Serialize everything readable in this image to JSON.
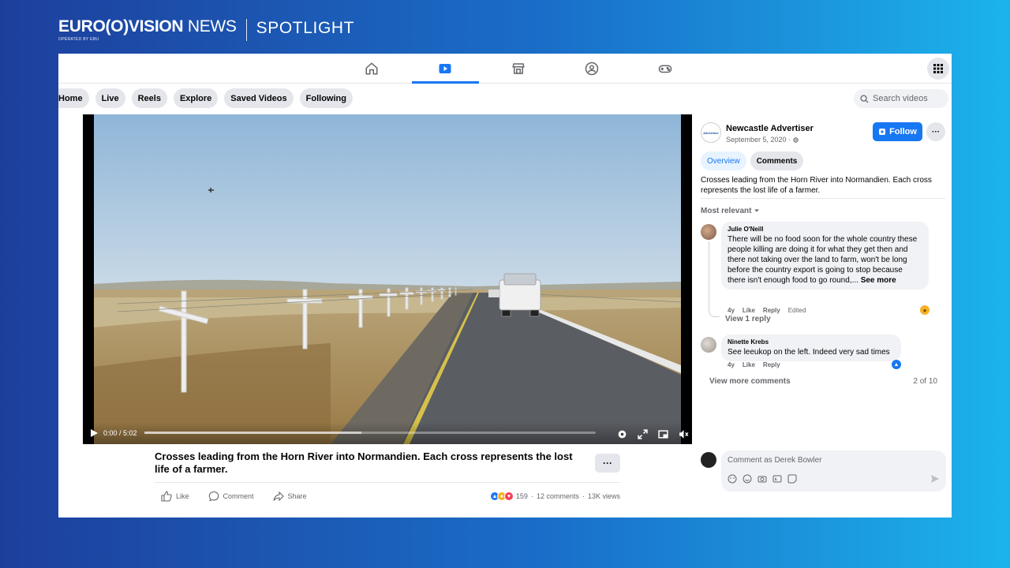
{
  "brand": {
    "logo_main": "EURO",
    "logo_vision": "VISION",
    "logo_news": "NEWS",
    "logo_sub": "OPERATED BY EBU",
    "spotlight": "SPOTLIGHT"
  },
  "topnav": {
    "icons": [
      "home-icon",
      "video-icon",
      "marketplace-icon",
      "groups-icon",
      "gaming-icon"
    ],
    "active_index": 1
  },
  "chips": [
    "Home",
    "Live",
    "Reels",
    "Explore",
    "Saved Videos",
    "Following"
  ],
  "search": {
    "placeholder": "Search videos"
  },
  "video": {
    "time": "0:00 / 5:02",
    "progress_fraction": 0.0
  },
  "post": {
    "title": "Crosses leading from the Horn River into Normandien. Each cross represents the lost life of a farmer.",
    "more": "···",
    "actions": {
      "like": "Like",
      "comment": "Comment",
      "share": "Share"
    },
    "reactions_count": "159",
    "comments": "12 comments",
    "views": "13K views",
    "stats_sep": "·"
  },
  "page": {
    "name": "Newcastle Advertiser",
    "date": "September 5, 2020 ·",
    "logo_text": "Advertiser",
    "follow": "Follow",
    "more": "···"
  },
  "tabs": {
    "overview": "Overview",
    "comments": "Comments"
  },
  "description": "Crosses leading from the Horn River into Normandien. Each cross represents the lost life of a farmer.",
  "sort": "Most relevant",
  "comments": [
    {
      "name": "Julie O'Neill",
      "text": "There will be no food soon for the whole country these people killing are doing it for what they get then and there not taking over the land to farm, won't be long before the country export is going to stop because there isn't enough food to go round,...",
      "see_more": "See more",
      "age": "4y",
      "like": "Like",
      "reply": "Reply",
      "edited": "Edited",
      "view_replies": "View 1 reply"
    },
    {
      "name": "Ninette Krebs",
      "text": "See leeukop on the left. Indeed very sad times",
      "age": "4y",
      "like": "Like",
      "reply": "Reply"
    }
  ],
  "view_more": "View more comments",
  "count": "2 of 10",
  "compose": {
    "placeholder": "Comment as Derek Bowler"
  },
  "colors": {
    "accent": "#1877f2",
    "chip_bg": "#e4e6eb"
  }
}
